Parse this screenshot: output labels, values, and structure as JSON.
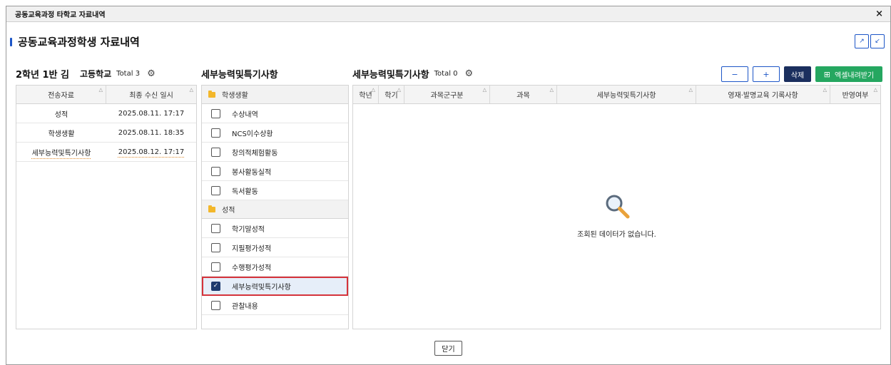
{
  "window": {
    "title": "공동교육과정 타학교 자료내역",
    "close_glyph": "×"
  },
  "page": {
    "heading": "공동교육과정학생 자료내역"
  },
  "left": {
    "student": "2학년 1반 김",
    "school": "고등학교",
    "total": "Total 3",
    "columns": [
      "전송자료",
      "최종 수신 일시"
    ],
    "rows": [
      [
        "성적",
        "2025.08.11. 17:17"
      ],
      [
        "학생생활",
        "2025.08.11. 18:35"
      ],
      [
        "세부능력및특기사항",
        "2025.08.12. 17:17"
      ]
    ]
  },
  "middle": {
    "title": "세부능력및특기사항",
    "groups": [
      {
        "label": "학생생활",
        "items": [
          "수상내역",
          "NCS이수상황",
          "창의적체험활동",
          "봉사활동실적",
          "독서활동"
        ]
      },
      {
        "label": "성적",
        "items": [
          "학기말성적",
          "지필평가성적",
          "수행평가성적",
          "세부능력및특기사항",
          "관찰내용"
        ]
      }
    ],
    "checked": "세부능력및특기사항"
  },
  "right": {
    "title": "세부능력및특기사항",
    "total": "Total 0",
    "columns": [
      "학년",
      "학기",
      "과목군구분",
      "과목",
      "세부능력및특기사항",
      "영재·발명교육 기록사항",
      "반영여부"
    ],
    "empty_text": "조회된 데이터가 없습니다.",
    "buttons": {
      "minus": "−",
      "plus": "+",
      "delete": "삭제",
      "excel": "엑셀내려받기"
    }
  },
  "footer": {
    "close_label": "닫기"
  },
  "colors": {
    "accent": "#1d56c7",
    "delete_bg": "#1b2f5e",
    "excel_bg": "#25a760",
    "highlight": "#d5333b",
    "folder": "#f3b72b"
  },
  "icons": [
    "close-icon",
    "expand-icon",
    "collapse-icon",
    "gear-icon",
    "folder-icon",
    "checkbox-icon",
    "magnifier-icon",
    "grid-icon"
  ]
}
